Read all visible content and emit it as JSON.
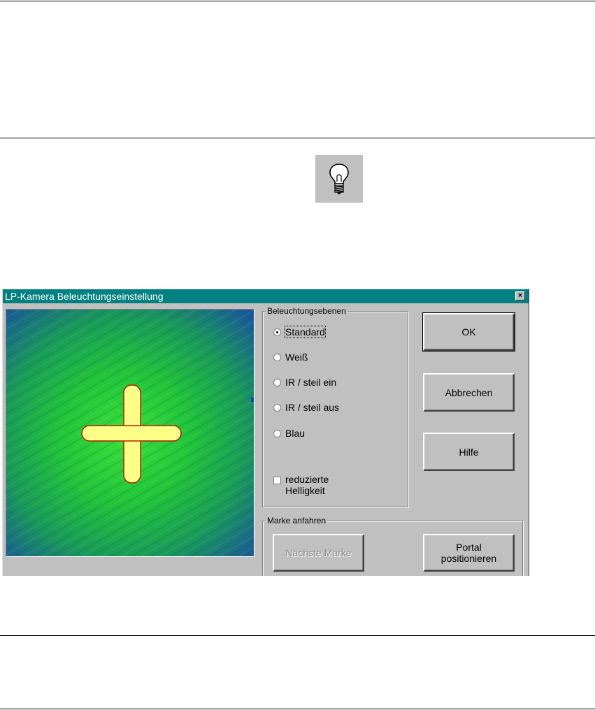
{
  "dialog": {
    "title": "LP-Kamera Beleuchtungseinstellung",
    "close_glyph": "×"
  },
  "lighting_group": {
    "legend": "Beleuchtungsebenen",
    "options": [
      {
        "label": "Standard",
        "selected": true
      },
      {
        "label": "Weiß",
        "selected": false
      },
      {
        "label": "IR / steil ein",
        "selected": false
      },
      {
        "label": "IR / steil aus",
        "selected": false
      },
      {
        "label": "Blau",
        "selected": false
      }
    ],
    "reduced_brightness": {
      "label_line1": "reduzierte",
      "label_line2": "Helligkeit",
      "checked": false
    }
  },
  "buttons": {
    "ok": "OK",
    "cancel": "Abbrechen",
    "help": "Hilfe"
  },
  "mark_group": {
    "legend": "Marke anfahren",
    "next_mark": "Nächste Marke",
    "portal_line1": "Portal",
    "portal_line2": "positionieren"
  },
  "colors": {
    "titlebar": "#008080",
    "face": "#c0c0c0",
    "camera_bg_center": "#28d428",
    "camera_bg_edge": "#1a5a9a",
    "cross_fill": "#ffff88",
    "cross_outline": "#b02000"
  },
  "icons": {
    "toolbar_button": "light-bulb-icon"
  }
}
